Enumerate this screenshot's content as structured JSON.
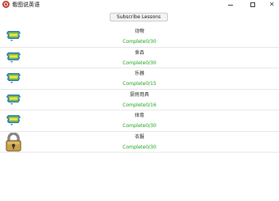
{
  "window": {
    "title": "看图说英语",
    "minimize_icon": "minimize-icon",
    "maximize_icon": "maximize-icon",
    "close_icon": "close-icon"
  },
  "toolbar": {
    "subscribe_label": "Subscribe Lessons"
  },
  "lessons": [
    {
      "title": "动物",
      "progress": "Complete0/30",
      "icon": "free-badge-icon"
    },
    {
      "title": "食品",
      "progress": "Complete0/30",
      "icon": "free-badge-icon"
    },
    {
      "title": "乐器",
      "progress": "Complete0/15",
      "icon": "free-badge-icon"
    },
    {
      "title": "厨房用具",
      "progress": "Complete0/16",
      "icon": "free-badge-icon"
    },
    {
      "title": "体育",
      "progress": "Complete0/30",
      "icon": "free-badge-icon"
    },
    {
      "title": "衣服",
      "progress": "Complete0/30",
      "icon": "lock-icon"
    }
  ],
  "colors": {
    "progress_text": "#1aa31a",
    "badge_green": "#7cc242",
    "badge_blue": "#2b76b9",
    "lock_body": "#c9a24a"
  }
}
